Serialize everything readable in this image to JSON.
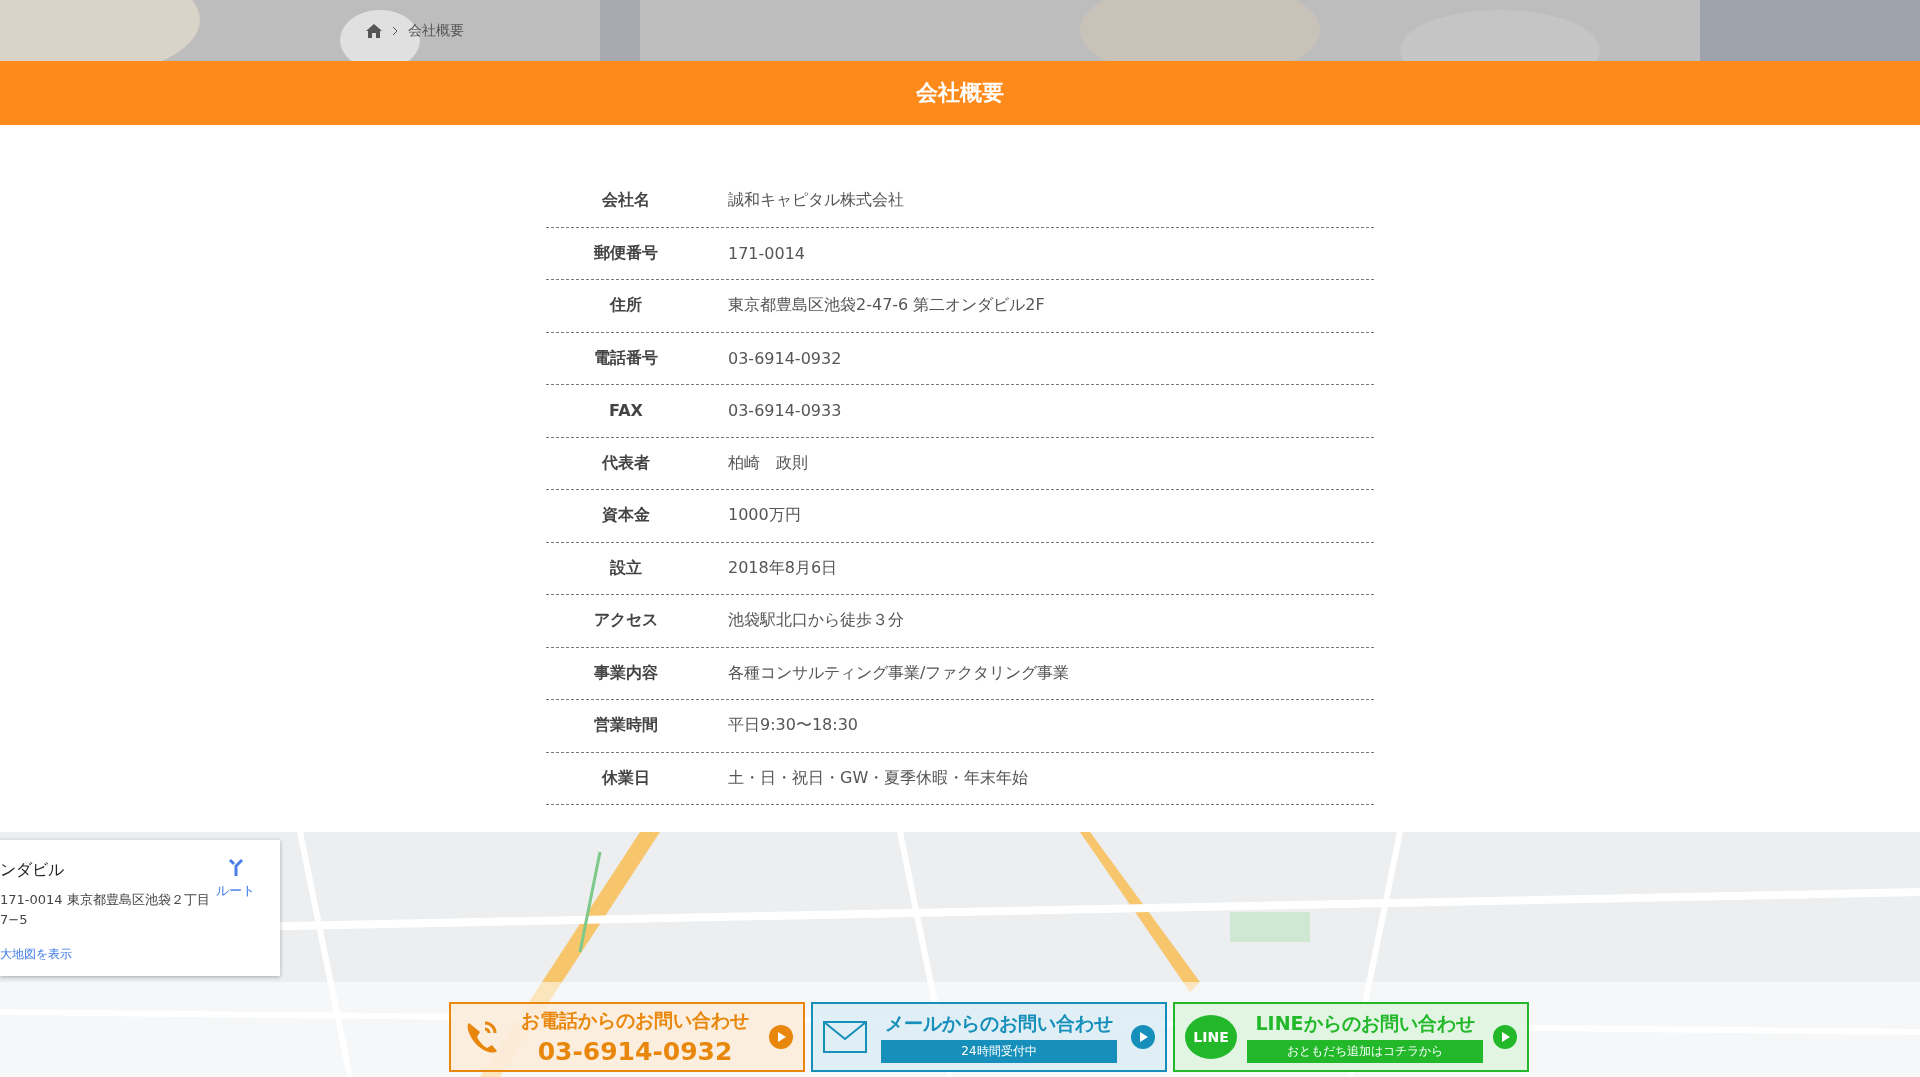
{
  "breadcrumb": {
    "current": "会社概要"
  },
  "page_title": "会社概要",
  "company_table": [
    {
      "label": "会社名",
      "value": "誠和キャピタル株式会社"
    },
    {
      "label": "郵便番号",
      "value": "171-0014"
    },
    {
      "label": "住所",
      "value": "東京都豊島区池袋2-47-6 第二オンダビル2F"
    },
    {
      "label": "電話番号",
      "value": "03-6914-0932"
    },
    {
      "label": "FAX",
      "value": "03-6914-0933"
    },
    {
      "label": "代表者",
      "value": "柏崎　政則"
    },
    {
      "label": "資本金",
      "value": "1000万円"
    },
    {
      "label": "設立",
      "value": "2018年8月6日"
    },
    {
      "label": "アクセス",
      "value": "池袋駅北口から徒歩３分"
    },
    {
      "label": "事業内容",
      "value": "各種コンサルティング事業/ファクタリング事業"
    },
    {
      "label": "営業時間",
      "value": "平日9:30〜18:30"
    },
    {
      "label": "休業日",
      "value": "土・日・祝日・GW・夏季休暇・年末年始"
    }
  ],
  "map_card": {
    "title": "ンダビル",
    "address": "171-0014 東京都豊島区池袋２丁目\n7−5",
    "route": "ルート",
    "larger_map": "大地図を表示"
  },
  "contact_buttons": [
    {
      "kind": "phone",
      "title": "お電話からのお問い合わせ",
      "sub": "03-6914-0932",
      "color": "#e8870c"
    },
    {
      "kind": "mail",
      "title": "メールからのお問い合わせ",
      "sub": "24時間受付中",
      "color": "#168fba"
    },
    {
      "kind": "line",
      "title": "LINEからのお問い合わせ",
      "icon_text": "LINE",
      "sub": "おともだち追加はコチラから",
      "color": "#22b82a"
    }
  ]
}
